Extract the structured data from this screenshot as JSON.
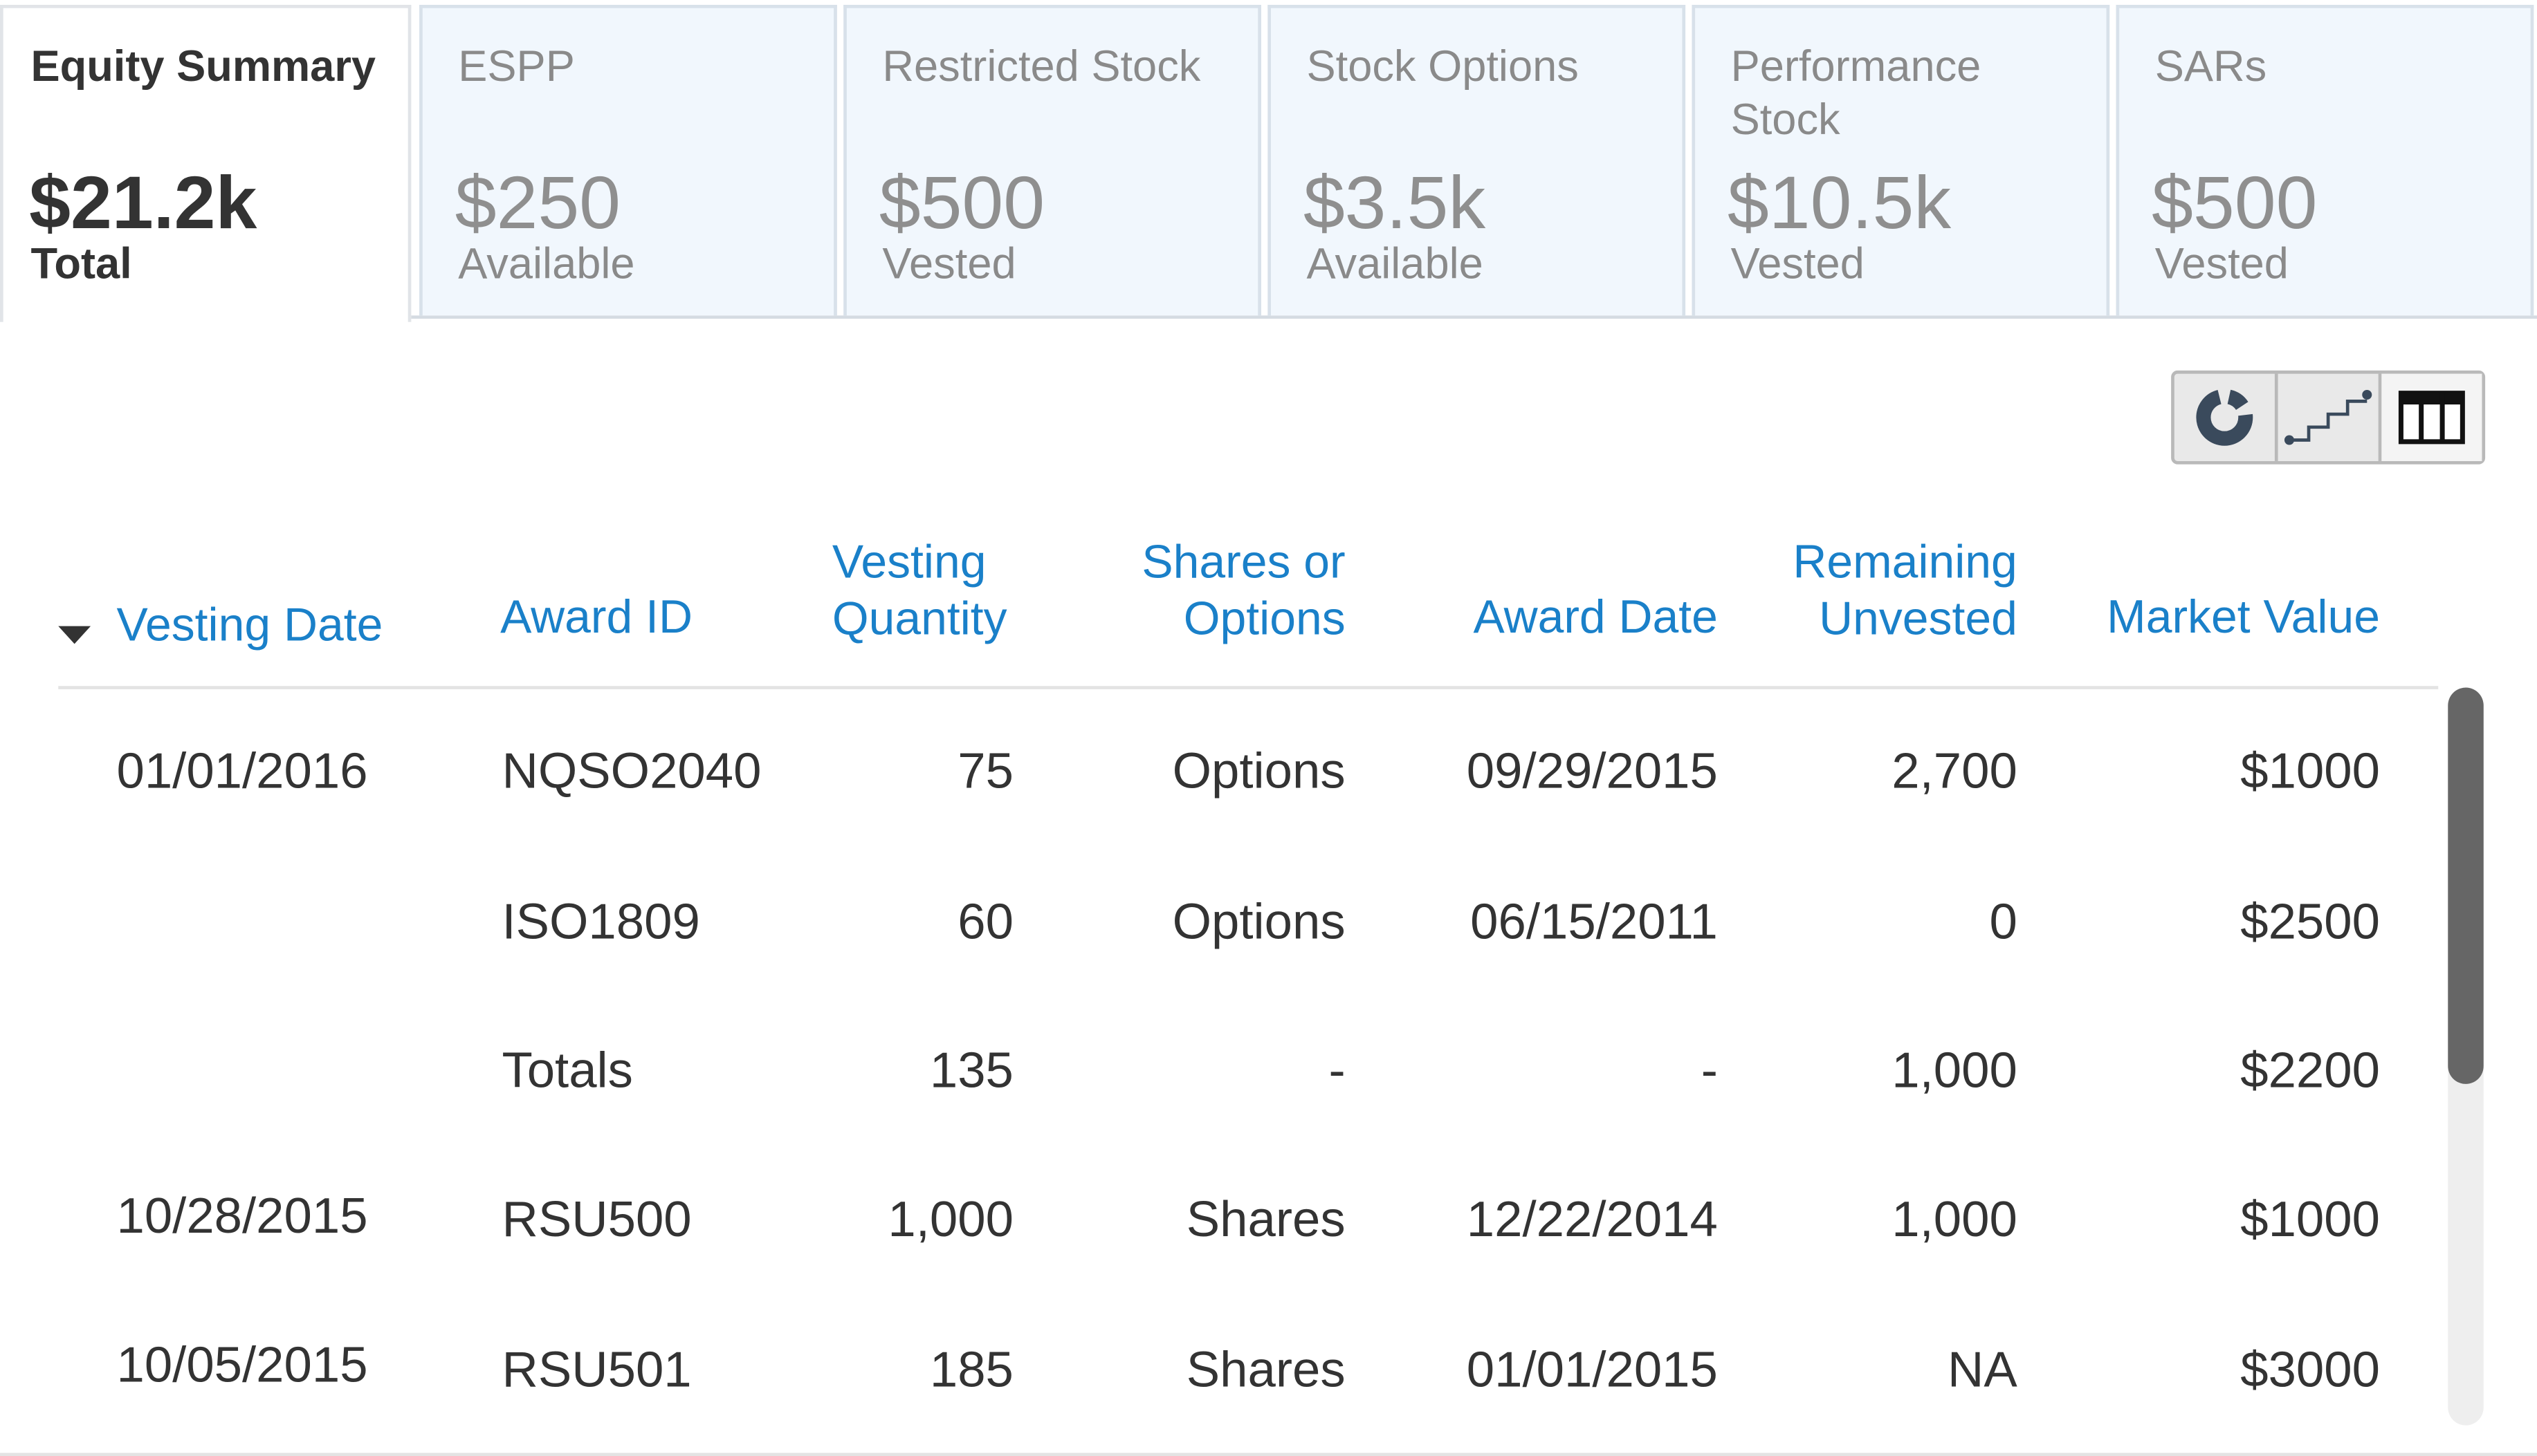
{
  "tabs": [
    {
      "title": "Equity Summary",
      "value": "$21.2k",
      "label": "Total",
      "active": true
    },
    {
      "title": "ESPP",
      "value": "$250",
      "label": "Available"
    },
    {
      "title": "Restricted Stock",
      "value": "$500",
      "label": "Vested"
    },
    {
      "title": "Stock Options",
      "value": "$3.5k",
      "label": "Available"
    },
    {
      "title": "Performance Stock",
      "value": "$10.5k",
      "label": "Vested"
    },
    {
      "title": "SARs",
      "value": "$500",
      "label": "Vested"
    }
  ],
  "view_toggles": [
    {
      "icon": "donut-chart-icon",
      "active": false
    },
    {
      "icon": "step-chart-icon",
      "active": false
    },
    {
      "icon": "columns-table-icon",
      "active": true
    }
  ],
  "table": {
    "sort_column": "Vesting Date",
    "sort_direction": "descending",
    "headers": {
      "vesting_date": "Vesting Date",
      "award_id": "Award ID",
      "vesting_quantity": "Vesting Quantity",
      "shares_or_options": "Shares or Options",
      "award_date": "Award Date",
      "remaining_unvested": "Remaining Unvested",
      "market_value": "Market Value"
    },
    "rows": [
      {
        "vesting_date": "01/01/2016",
        "award_id": "NQSO2040",
        "vesting_quantity": "75",
        "shares_or_options": "Options",
        "award_date": "09/29/2015",
        "remaining_unvested": "2,700",
        "market_value": "$1000"
      },
      {
        "vesting_date": "",
        "award_id": "ISO1809",
        "vesting_quantity": "60",
        "shares_or_options": "Options",
        "award_date": "06/15/2011",
        "remaining_unvested": "0",
        "market_value": "$2500"
      },
      {
        "vesting_date": "",
        "award_id": "Totals",
        "vesting_quantity": "135",
        "shares_or_options": "-",
        "award_date": "-",
        "remaining_unvested": "1,000",
        "market_value": "$2200"
      },
      {
        "vesting_date": "10/28/2015",
        "award_id": "RSU500",
        "vesting_quantity": "1,000",
        "shares_or_options": "Shares",
        "award_date": "12/22/2014",
        "remaining_unvested": "1,000",
        "market_value": "$1000"
      },
      {
        "vesting_date": "10/05/2015",
        "award_id": "RSU501",
        "vesting_quantity": "185",
        "shares_or_options": "Shares",
        "award_date": "01/01/2015",
        "remaining_unvested": "NA",
        "market_value": "$3000"
      }
    ]
  },
  "colors": {
    "header_link": "#1a80c9",
    "tab_inactive_bg": "#f1f7fd",
    "text": "#333333",
    "muted_text": "#8a8a8a",
    "scrollbar_thumb": "#666666"
  }
}
